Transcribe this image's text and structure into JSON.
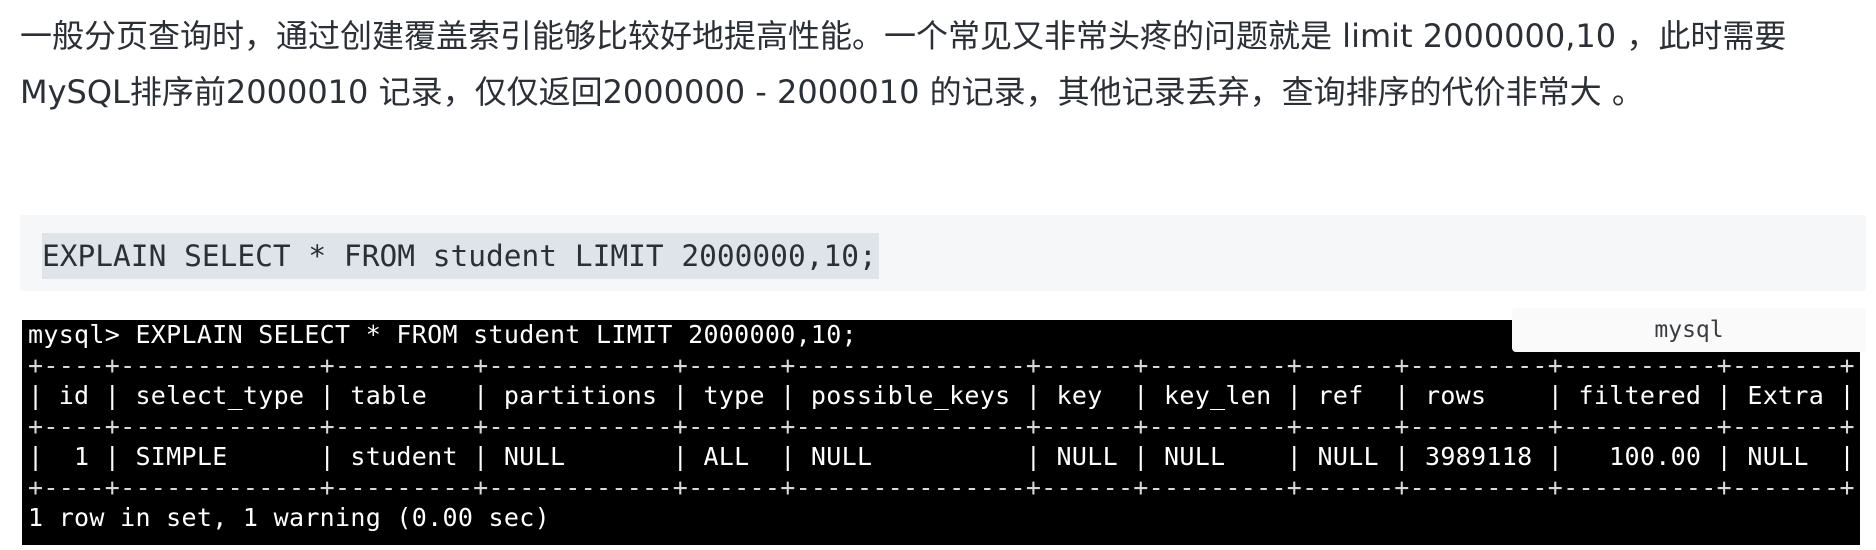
{
  "paragraph": {
    "text": "一般分页查询时，通过创建覆盖索引能够比较好地提高性能。一个常见又非常头疼的问题就是 limit 2000000,10 ，此时需要MySQL排序前2000010 记录，仅仅返回2000000 - 2000010 的记录，其他记录丢弃，查询排序的代价非常大 。"
  },
  "code_block": {
    "sql": "EXPLAIN SELECT * FROM student LIMIT 2000000,10;"
  },
  "terminal": {
    "language": "mysql",
    "prompt_line": "mysql> EXPLAIN SELECT * FROM student LIMIT 2000000,10;",
    "separator": "+----+-------------+---------+------------+------+---------------+------+---------+------+---------+----------+-------+",
    "header_row": "| id | select_type | table   | partitions | type | possible_keys | key  | key_len | ref  | rows    | filtered | Extra |",
    "data_row": "|  1 | SIMPLE      | student | NULL       | ALL  | NULL          | NULL | NULL    | NULL | 3989118 |   100.00 | NULL  |",
    "footer": "1 row in set, 1 warning (0.00 sec)",
    "columns": [
      "id",
      "select_type",
      "table",
      "partitions",
      "type",
      "possible_keys",
      "key",
      "key_len",
      "ref",
      "rows",
      "filtered",
      "Extra"
    ],
    "rows": [
      [
        "1",
        "SIMPLE",
        "student",
        "NULL",
        "ALL",
        "NULL",
        "NULL",
        "NULL",
        "NULL",
        "3989118",
        "100.00",
        "NULL"
      ]
    ]
  }
}
